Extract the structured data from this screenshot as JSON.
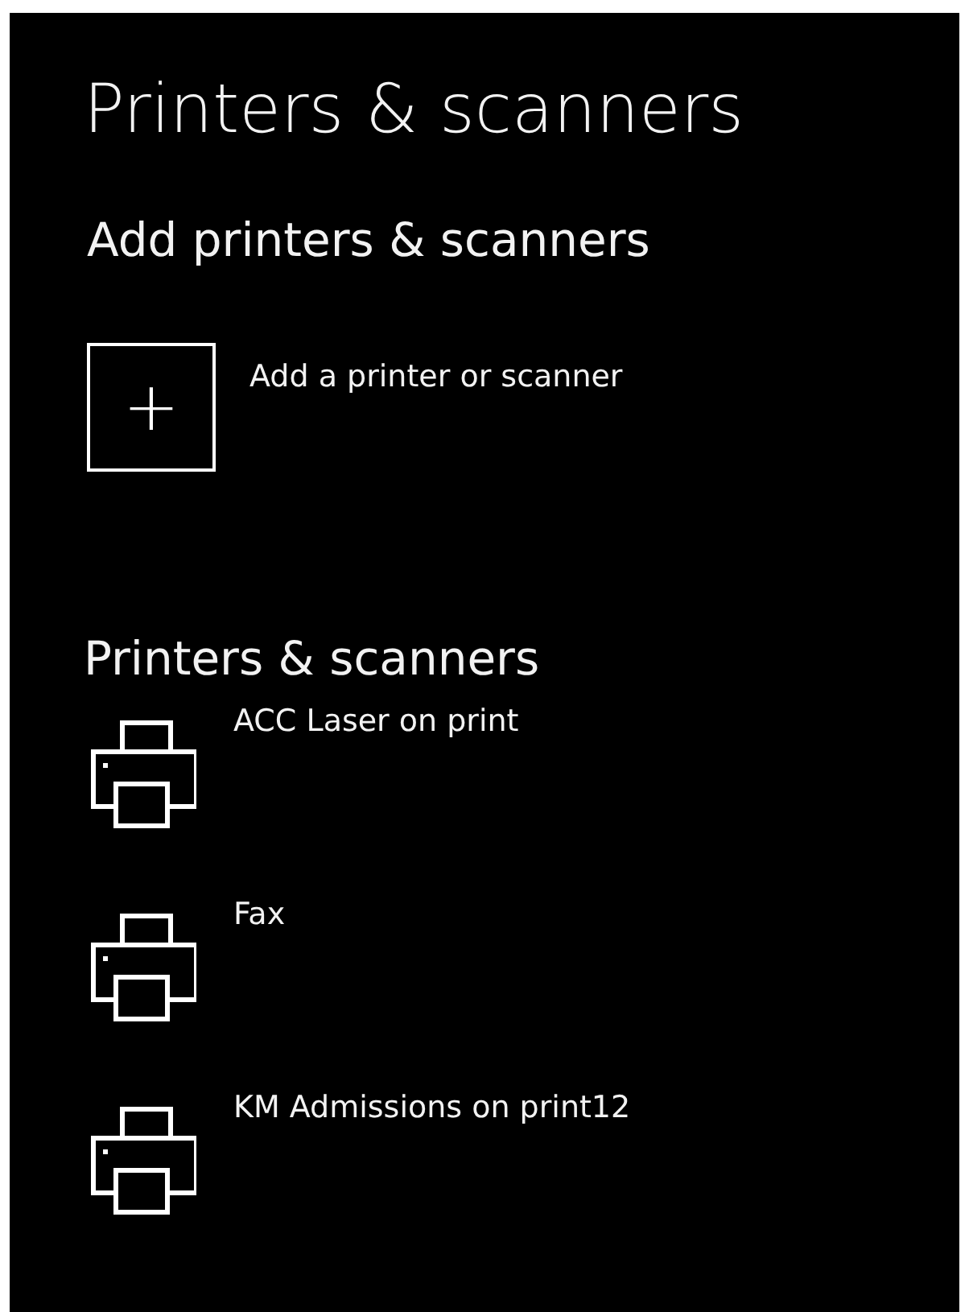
{
  "title": "Printers & scanners",
  "add_section": {
    "heading": "Add printers & scanners",
    "button": {
      "icon": "+",
      "label": "Add a printer or scanner"
    }
  },
  "devices_section": {
    "heading": "Printers & scanners",
    "devices": [
      {
        "name": "ACC Laser on print"
      },
      {
        "name": "Fax"
      },
      {
        "name": "KM Admissions on print12"
      }
    ]
  }
}
